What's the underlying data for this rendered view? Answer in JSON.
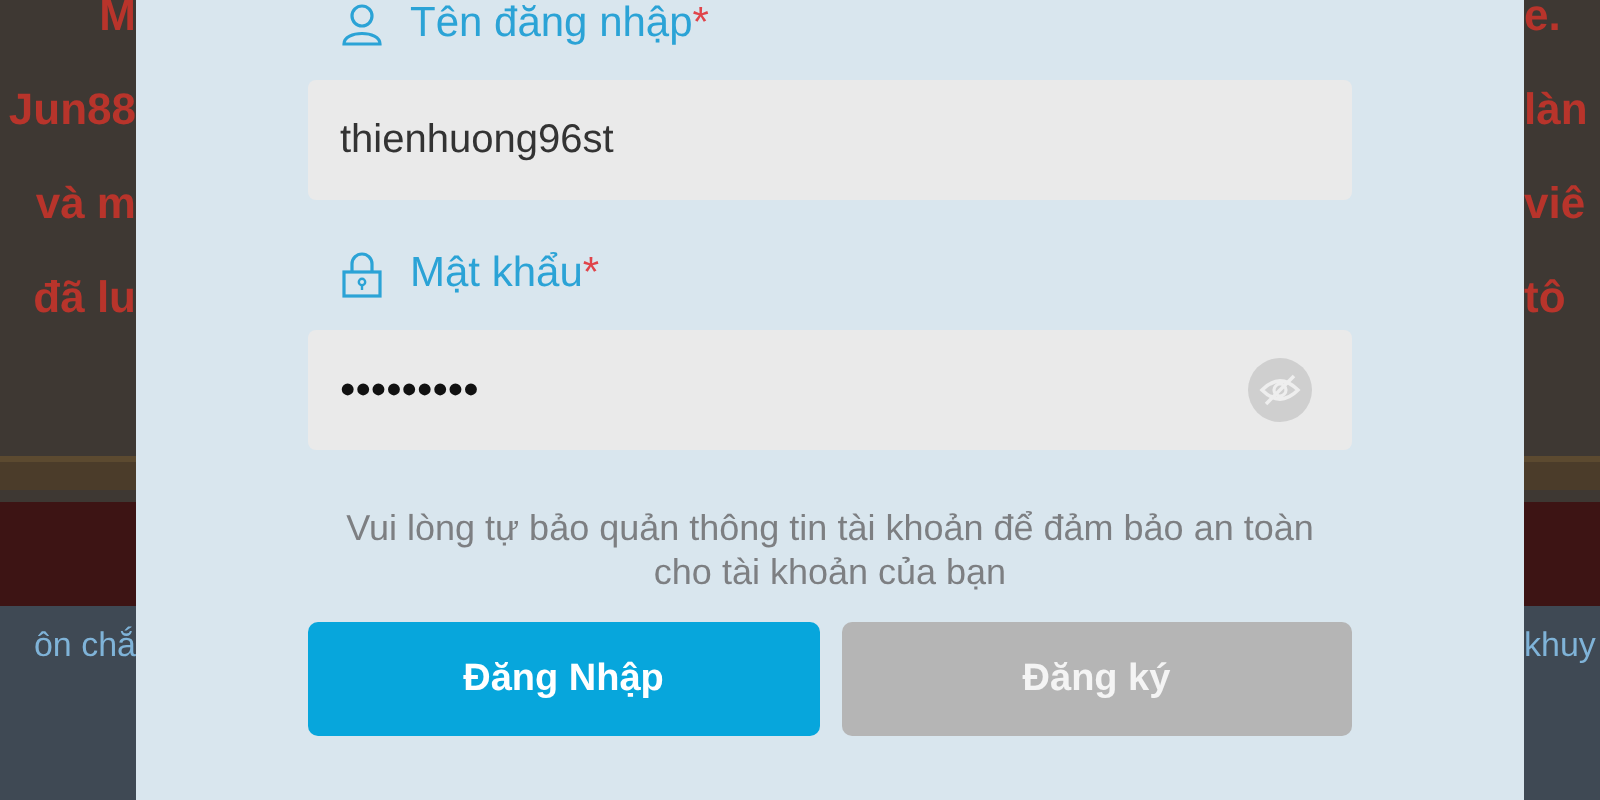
{
  "background_page": {
    "left_lines": [
      "M",
      "Jun88",
      "và m",
      "đã lu"
    ],
    "right_lines": [
      "e.",
      "làn",
      "viê",
      "tô"
    ],
    "left_link": "ôn chắ",
    "right_link": "khuy"
  },
  "login_form": {
    "fields": [
      {
        "kind": "text",
        "label": "Tên đăng nhập",
        "required_mark": "*",
        "value": "thienhuong96st"
      },
      {
        "kind": "password",
        "label": "Mật khẩu",
        "required_mark": "*",
        "value": "•••••••••"
      }
    ],
    "notice": "Vui lòng tự bảo quản thông tin tài khoản để đảm bảo an toàn cho tài khoản của bạn",
    "buttons": [
      {
        "label": "Đăng Nhập",
        "kind": "primary"
      },
      {
        "label": "Đăng ký",
        "kind": "secondary"
      }
    ]
  }
}
